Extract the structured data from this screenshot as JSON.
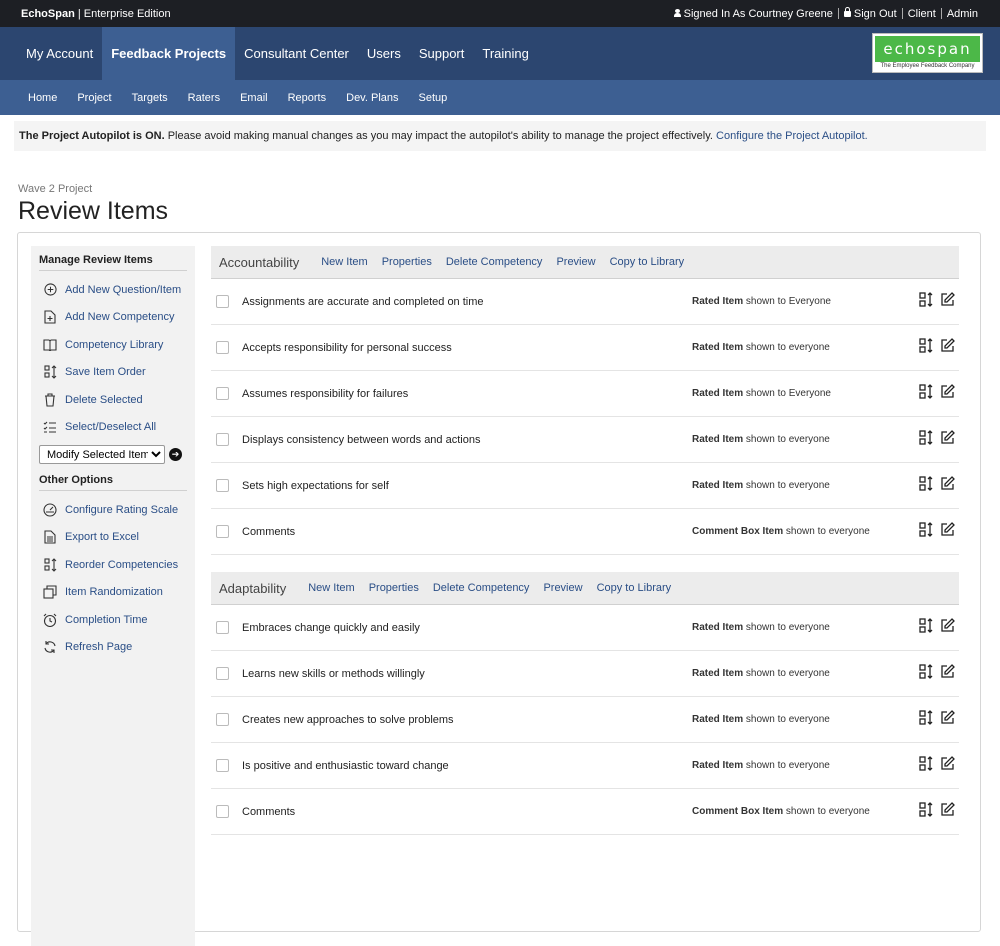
{
  "topbar": {
    "brand": "EchoSpan",
    "edition": "Enterprise Edition",
    "signed_in": "Signed In As Courtney Greene",
    "sign_out": "Sign Out",
    "client": "Client",
    "admin": "Admin"
  },
  "nav1": {
    "items": [
      "My Account",
      "Feedback Projects",
      "Consultant Center",
      "Users",
      "Support",
      "Training"
    ],
    "active": "Feedback Projects"
  },
  "logo": {
    "word": "echospan",
    "tagline": "The Employee Feedback Company",
    "color": "#4cb848"
  },
  "nav2": {
    "items": [
      "Home",
      "Project",
      "Targets",
      "Raters",
      "Email",
      "Reports",
      "Dev. Plans",
      "Setup"
    ]
  },
  "notice": {
    "bold": "The Project Autopilot is ON.",
    "text": " Please avoid making manual changes as you may impact the autopilot's ability to manage the project effectively. ",
    "link": "Configure the Project Autopilot."
  },
  "header": {
    "subtitle": "Wave 2 Project",
    "title": "Review Items"
  },
  "sidebar": {
    "manage_title": "Manage Review Items",
    "manage_links": [
      {
        "label": "Add New Question/Item",
        "icon": "plus-circle-icon"
      },
      {
        "label": "Add New Competency",
        "icon": "add-document-icon"
      },
      {
        "label": "Competency Library",
        "icon": "book-icon"
      },
      {
        "label": "Save Item Order",
        "icon": "reorder-icon"
      },
      {
        "label": "Delete Selected",
        "icon": "trash-icon"
      },
      {
        "label": "Select/Deselect All",
        "icon": "checklist-icon"
      }
    ],
    "modify_select": "Modify Selected Items",
    "other_title": "Other Options",
    "other_links": [
      {
        "label": "Configure Rating Scale",
        "icon": "gauge-icon"
      },
      {
        "label": "Export to Excel",
        "icon": "export-document-icon"
      },
      {
        "label": "Reorder Competencies",
        "icon": "reorder-icon"
      },
      {
        "label": "Item Randomization",
        "icon": "shuffle-icon"
      },
      {
        "label": "Completion Time",
        "icon": "clock-icon"
      },
      {
        "label": "Refresh Page",
        "icon": "refresh-icon"
      }
    ]
  },
  "competency_actions": [
    "New Item",
    "Properties",
    "Delete Competency",
    "Preview",
    "Copy to Library"
  ],
  "competencies": [
    {
      "name": "Accountability",
      "items": [
        {
          "text": "Assignments are accurate and completed on time",
          "type": "Rated Item",
          "audience": " shown to Everyone"
        },
        {
          "text": "Accepts responsibility for personal success",
          "type": "Rated Item",
          "audience": " shown to everyone"
        },
        {
          "text": "Assumes responsibility for failures",
          "type": "Rated Item",
          "audience": " shown to Everyone"
        },
        {
          "text": "Displays consistency between words and actions",
          "type": "Rated Item",
          "audience": " shown to everyone"
        },
        {
          "text": "Sets high expectations for self",
          "type": "Rated Item",
          "audience": " shown to everyone"
        },
        {
          "text": "Comments",
          "type": "Comment Box Item",
          "audience": " shown to everyone"
        }
      ]
    },
    {
      "name": "Adaptability",
      "items": [
        {
          "text": "Embraces change quickly and easily",
          "type": "Rated Item",
          "audience": " shown to everyone"
        },
        {
          "text": "Learns new skills or methods willingly",
          "type": "Rated Item",
          "audience": " shown to everyone"
        },
        {
          "text": "Creates new approaches to solve problems",
          "type": "Rated Item",
          "audience": " shown to everyone"
        },
        {
          "text": "Is positive and enthusiastic toward change",
          "type": "Rated Item",
          "audience": " shown to everyone"
        },
        {
          "text": "Comments",
          "type": "Comment Box Item",
          "audience": " shown to everyone"
        }
      ]
    }
  ],
  "colors": {
    "nav_dark": "#2c4670",
    "nav_light": "#3d5f92",
    "link": "#2a4e86"
  }
}
